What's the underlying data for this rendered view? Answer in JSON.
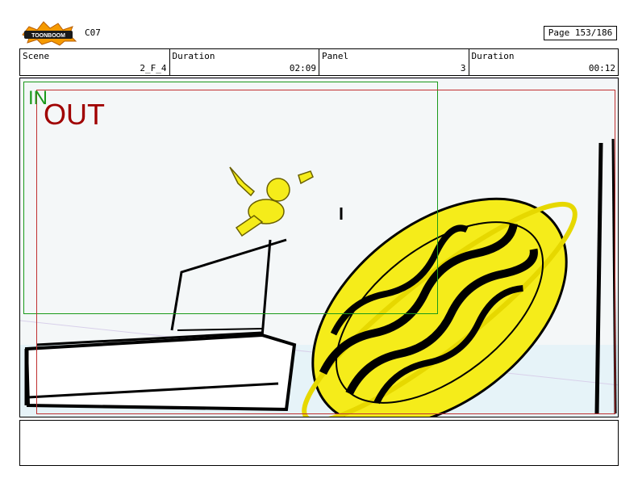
{
  "header": {
    "logo_text": "TOONBOOM",
    "code": "C07",
    "page_label": "Page 153/186"
  },
  "info": [
    {
      "label": "Scene",
      "value": "2_F_4"
    },
    {
      "label": "Duration",
      "value": "02:09"
    },
    {
      "label": "Panel",
      "value": "3"
    },
    {
      "label": "Duration",
      "value": "00:12"
    }
  ],
  "frame": {
    "in_label": "IN",
    "out_label": "OUT",
    "in_color": "#1a9a1a",
    "out_color": "#a00000"
  },
  "notes": {
    "text": ""
  }
}
